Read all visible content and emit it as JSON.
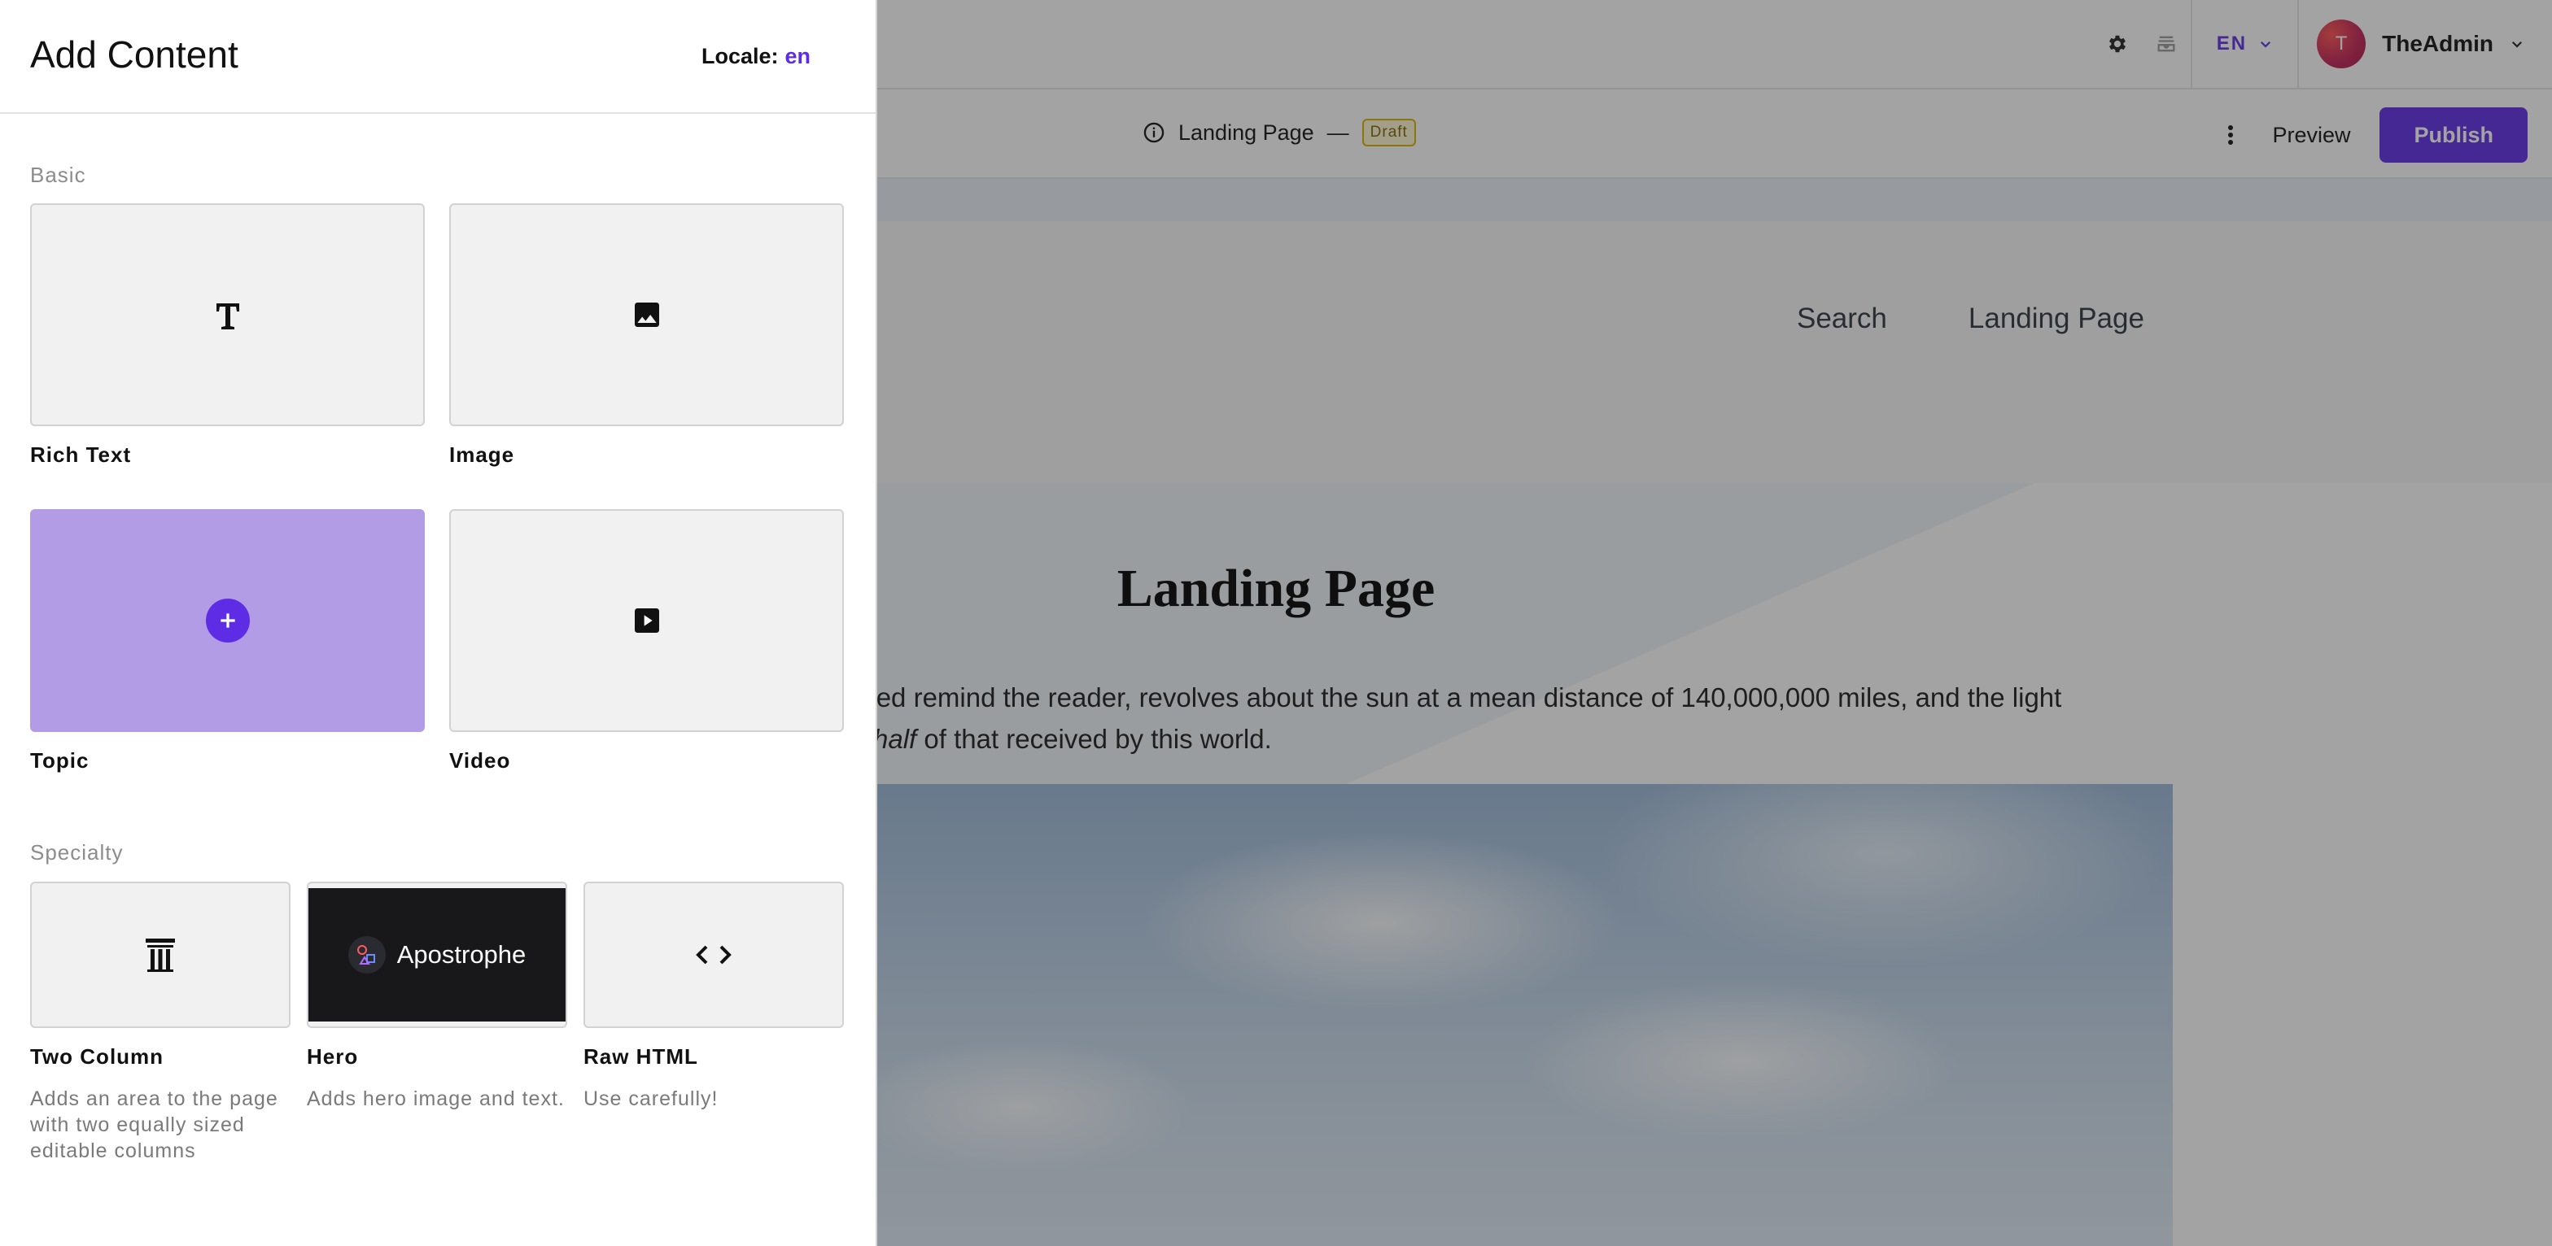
{
  "admin_bar": {
    "locale": "EN",
    "user": {
      "initial": "T",
      "name": "TheAdmin"
    }
  },
  "doc_bar": {
    "title": "Landing Page",
    "separator": "—",
    "status": "Draft",
    "preview_label": "Preview",
    "publish_label": "Publish"
  },
  "site_nav": {
    "items": [
      "Search",
      "Landing Page"
    ]
  },
  "hero": {
    "title": "Landing Page",
    "line1": "need remind the reader, revolves about the sun at a mean distance of 140,000,000 miles, and the light",
    "line2_italic": "ly half",
    "line2_rest": " of that received by this world."
  },
  "panel": {
    "title": "Add Content",
    "locale_label": "Locale:",
    "locale_value": "en",
    "groups": [
      {
        "label": "Basic",
        "items": [
          {
            "label": "Rich Text",
            "icon": "rich-text-icon"
          },
          {
            "label": "Image",
            "icon": "image-icon"
          },
          {
            "label": "Topic",
            "icon": "plus-circle-icon"
          },
          {
            "label": "Video",
            "icon": "video-icon"
          }
        ]
      },
      {
        "label": "Specialty",
        "items": [
          {
            "label": "Two Column",
            "description": "Adds an area to the page with two equally sized editable columns",
            "icon": "columns-icon"
          },
          {
            "label": "Hero",
            "description": "Adds hero image and text.",
            "preview_text": "Apostrophe",
            "icon": "apostrophe-logo"
          },
          {
            "label": "Raw HTML",
            "description": "Use carefully!",
            "icon": "code-icon"
          }
        ]
      }
    ]
  },
  "colors": {
    "accent": "#5e2ce4",
    "topic_tile": "#b39ce6",
    "draft": "#d4b000"
  }
}
